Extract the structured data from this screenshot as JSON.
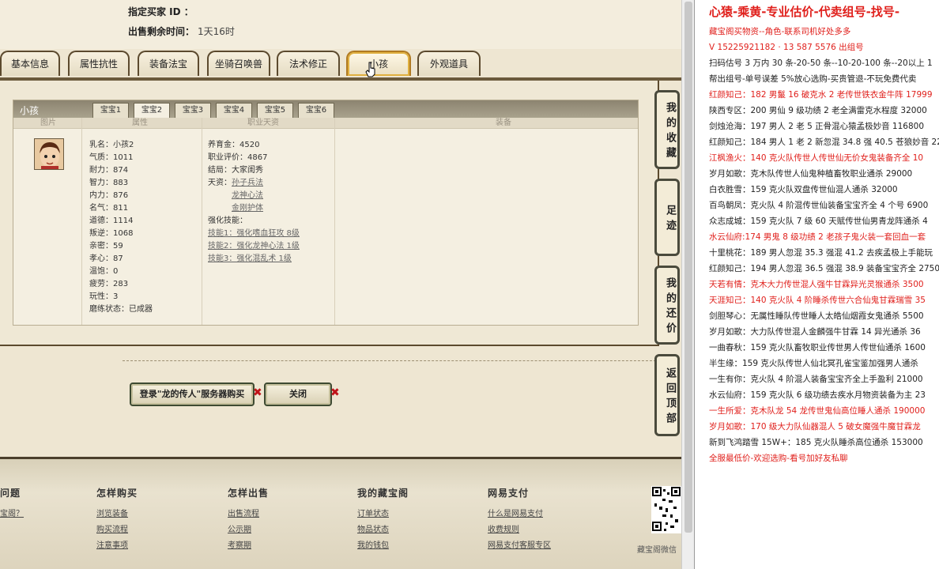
{
  "top": {
    "buyer_label": "指定买家 ID ：",
    "remaining_label": "出售剩余时间：",
    "remaining_value": "1天16时"
  },
  "tabs": [
    "基本信息",
    "属性抗性",
    "装备法宝",
    "坐骑召唤兽",
    "法术修正",
    "小孩",
    "外观道具"
  ],
  "child_panel": {
    "title": "小孩",
    "subtabs": [
      "宝宝1",
      "宝宝2",
      "宝宝3",
      "宝宝4",
      "宝宝5",
      "宝宝6"
    ],
    "columns": [
      "图片",
      "属性",
      "职业天资",
      "装备"
    ],
    "attributes": [
      "乳名：小孩2",
      "气质：1011",
      "耐力：874",
      "智力：883",
      "内力：876",
      "名气：811",
      "道德：1114",
      "叛逆：1068",
      "亲密：59",
      "孝心：87",
      "温饱：0",
      "疲劳：283",
      "玩性：3",
      "磨练状态：已成器"
    ],
    "talent": {
      "nurture": "养育金：4520",
      "career_eval": "职业评价：4867",
      "ending": "结局：大家闺秀",
      "tianzi_label": "天资：",
      "tianzi": [
        "孙子兵法",
        "龙神心法",
        "金刚护体"
      ],
      "skills_label": "强化技能：",
      "skills": [
        "技能1：强化嗜血狂攻 8级",
        "技能2：强化龙神心法 1级",
        "技能3：强化混乱术 1级"
      ]
    }
  },
  "buttons": {
    "login_buy": "登录\"龙的传人\"服务器购买",
    "close": "关闭",
    "x_mark": "✖"
  },
  "side_nav": [
    "我的收藏",
    "足迹",
    "我的还价",
    "返回顶部"
  ],
  "footer": {
    "headings": [
      "问题",
      "怎样购买",
      "怎样出售",
      "我的藏宝阁",
      "网易支付"
    ],
    "col0": [
      "宝阁？"
    ],
    "col1": [
      "浏览装备",
      "购买流程",
      "注意事项"
    ],
    "col2": [
      "出售流程",
      "公示期",
      "考察期"
    ],
    "col3": [
      "订单状态",
      "物品状态",
      "我的钱包"
    ],
    "col4": [
      "什么是网易支付",
      "收费规则",
      "网易支付客服专区"
    ],
    "qr_label": "藏宝阁微信"
  },
  "right_doc": {
    "title": "心猿-乘黄-专业估价-代卖组号-找号-",
    "lines": [
      {
        "text": "藏宝阁买物资--角色-联系司机好处多多",
        "color": "red"
      },
      {
        "text": "V 15225921182 · 13 587 5576  出组号",
        "color": "red"
      },
      {
        "text": "扫码估号 3 万内 30 条-20-50 条--10-20-100 条--20以上 1",
        "color": "blk"
      },
      {
        "text": "帮出组号-单号误差 5%放心选购-买贵管退-不玩免费代卖",
        "color": "blk"
      },
      {
        "text": "红颜知己：182 男鬣 16 破克水 2 老传世铁衣金牛阵 17999",
        "color": "red"
      },
      {
        "text": "陕西专区：200 男仙 9 级功绩 2 老全满雷克水程度 32000",
        "color": "blk"
      },
      {
        "text": "剑烛沧海：197 男人 2 老 5 正骨混心猿孟极妙音 116800",
        "color": "blk"
      },
      {
        "text": "红颜知己：184 男人 1 老 2 新忽混 34.8 强 40.5 苍狼妙音 22",
        "color": "blk"
      },
      {
        "text": "江枫渔火：140 克火队传世人传世仙无价女鬼装备齐全 10",
        "color": "red"
      },
      {
        "text": "岁月如歌：克木队传世人仙鬼种植畜牧职业通杀 29000",
        "color": "blk"
      },
      {
        "text": "白衣胜雪：159 克火队双盘传世仙混人通杀 32000",
        "color": "blk"
      },
      {
        "text": "百鸟朝凤：克火队 4 阶混传世仙装备宝宝齐全 4 个号 6900",
        "color": "blk"
      },
      {
        "text": "众志成城：159 克火队 7 级 60 天赋传世仙男青龙阵通杀 4",
        "color": "blk"
      },
      {
        "text": "水云仙府:174 男鬼 8 级功绩 2 老孩子鬼火装一套回血一套",
        "color": "red"
      },
      {
        "text": "十里桃花：189 男人忽混 35.3 强混 41.2 去疾孟极上手能玩",
        "color": "blk"
      },
      {
        "text": "红颜知己：194 男人忽混 36.5 强混 38.9 装备宝宝齐全 2750",
        "color": "blk"
      },
      {
        "text": "天若有情：克木大力传世混人强牛甘霖异光灵猴通杀 3500",
        "color": "red"
      },
      {
        "text": "天涯知己：140 克火队 4 阶睡杀传世六合仙鬼甘霖瑞雪 35",
        "color": "red"
      },
      {
        "text": "剑胆琴心：无属性睡队传世睡人太皓仙烟霞女鬼通杀 5500",
        "color": "blk"
      },
      {
        "text": "岁月如歌：大力队传世混人金麟强牛甘霖 14 异光通杀 36",
        "color": "blk"
      },
      {
        "text": "一曲春秋：159 克火队畜牧职业传世男人传世仙通杀 1600",
        "color": "blk"
      },
      {
        "text": "半生缘：159 克火队传世人仙北冥孔雀宝鉴加强男人通杀",
        "color": "blk"
      },
      {
        "text": "一生有你：克火队 4 阶混人装备宝宝齐全上手盈利 21000",
        "color": "blk"
      },
      {
        "text": "水云仙府：159 克火队 6 级功绩去疾水月物资装备为主 23",
        "color": "blk"
      },
      {
        "text": "一生所爱：克木队龙 54 龙传世鬼仙高位睡人通杀 190000",
        "color": "red"
      },
      {
        "text": "岁月如歌：170 级大力队仙器混人 5 破女魔强牛魔甘霖龙",
        "color": "red"
      },
      {
        "text": "新到飞鸿踏雪 15W+：185 克火队睡杀高位通杀 153000",
        "color": "blk"
      },
      {
        "text": "全服最低价-欢迎选购-看号加好友私聊",
        "color": "red"
      }
    ]
  }
}
